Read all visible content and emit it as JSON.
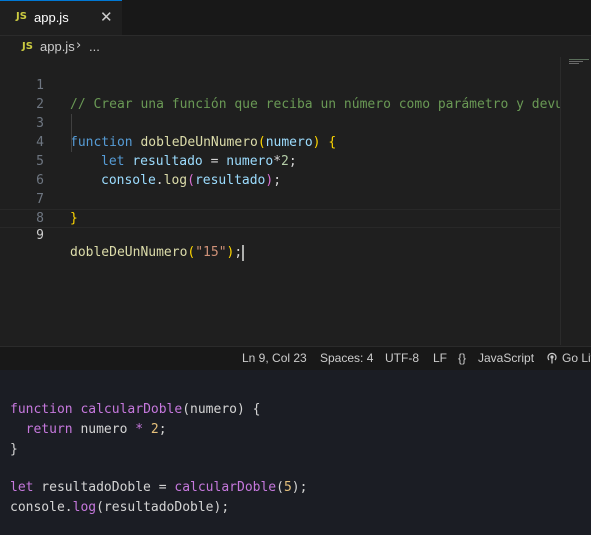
{
  "tab": {
    "icon": "js-icon",
    "icon_text": "JS",
    "label": "app.js",
    "close": "✕"
  },
  "breadcrumb": {
    "icon_text": "JS",
    "file": "app.js",
    "sep": "›",
    "more": "..."
  },
  "editor": {
    "line_numbers": [
      "1",
      "2",
      "3",
      "4",
      "5",
      "6",
      "7",
      "8",
      "9"
    ],
    "current_line": "9",
    "lines": {
      "l1": "// Crear una función que reciba un número como parámetro y devue",
      "l3_kw": "function",
      "l3_fn": "dobleDeUnNumero",
      "l3_open": "(",
      "l3_param": "numero",
      "l3_close": ")",
      "l3_brace": "{",
      "l4_kw": "let",
      "l4_var": "resultado",
      "l4_eq": " = ",
      "l4_var2": "numero",
      "l4_op": "*",
      "l4_num": "2",
      "l4_semi": ";",
      "l5_obj": "console",
      "l5_dot": ".",
      "l5_fn": "log",
      "l5_open": "(",
      "l5_arg": "resultado",
      "l5_close": ")",
      "l5_semi": ";",
      "l7_brace": "}",
      "l9_fn": "dobleDeUnNumero",
      "l9_open": "(",
      "l9_str": "\"15\"",
      "l9_close": ")",
      "l9_semi": ";"
    }
  },
  "status": {
    "position": "Ln 9, Col 23",
    "spaces": "Spaces: 4",
    "encoding": "UTF-8",
    "eol": "LF",
    "lang_icon": "{}",
    "language": "JavaScript",
    "golive_icon": "broadcast-icon",
    "golive": "Go Liv"
  },
  "snippet": {
    "l1_kw": "function",
    "l1_fn": "calcularDoble",
    "l1_rest": "(numero) {",
    "l2_kw": "return",
    "l2_rest1": " numero ",
    "l2_op": "*",
    "l2_num": " 2",
    "l2_semi": ";",
    "l3": "}",
    "l5_kw": "let",
    "l5_rest1": " resultadoDoble = ",
    "l5_fn": "calcularDoble",
    "l5_rest2": "(",
    "l5_num": "5",
    "l5_rest3": ");",
    "l6_obj": "console.",
    "l6_fn": "log",
    "l6_rest": "(resultadoDoble);"
  }
}
